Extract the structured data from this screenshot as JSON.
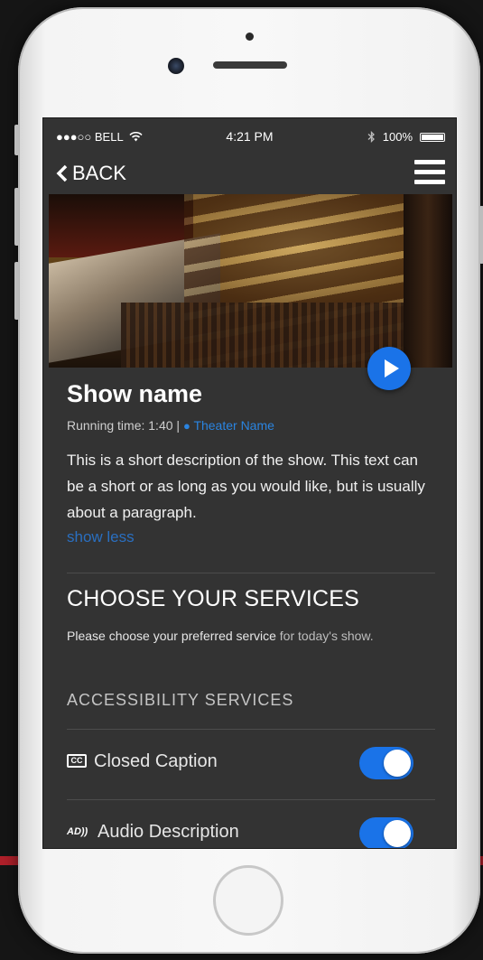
{
  "status_bar": {
    "carrier": "●●●○○ BELL",
    "time": "4:21 PM",
    "battery": "100%"
  },
  "nav": {
    "back_label": "BACK"
  },
  "show": {
    "title": "Show name",
    "running_time": "Running time: 1:40 |",
    "theater": "Theater Name",
    "description": "This is a short description of the show. This text can be a short or as long as you would like, but is usually about a paragraph.",
    "show_less": "show less"
  },
  "services": {
    "title": "CHOOSE YOUR SERVICES",
    "subtitle_main": "Please choose your preferred service",
    "subtitle_rest": " for today's show.",
    "section_title": "ACCESSIBILITY SERVICES",
    "items": [
      {
        "icon": "cc-icon",
        "icon_text": "CC",
        "label": "Closed Caption",
        "enabled": true
      },
      {
        "icon": "audio-description-icon",
        "icon_text": "AD))",
        "label": "Audio Description",
        "enabled": true
      }
    ]
  },
  "colors": {
    "accent": "#1a73e8",
    "link": "#2a84e0",
    "screen_bg": "#333333"
  }
}
